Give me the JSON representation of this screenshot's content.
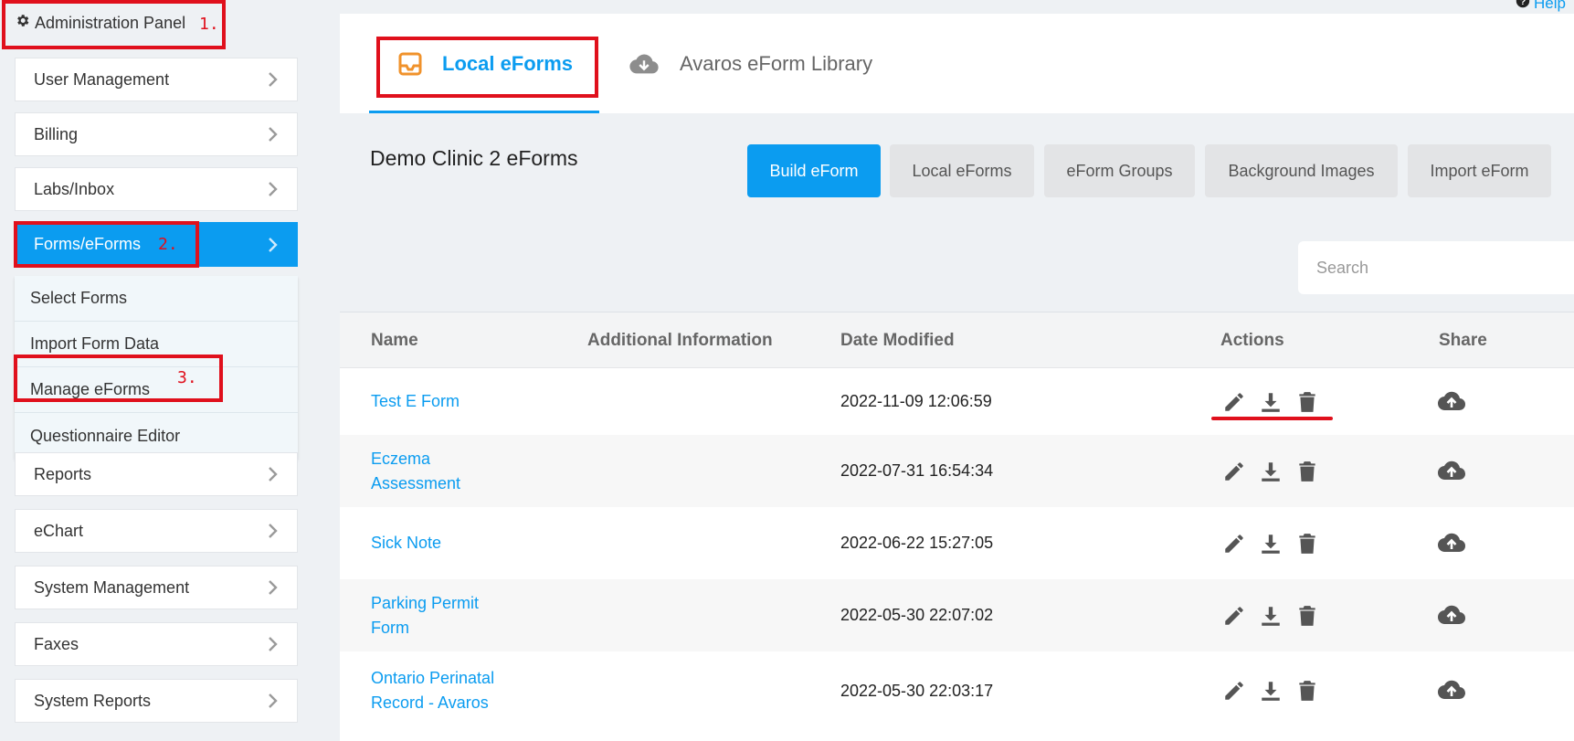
{
  "admin_panel": {
    "title": "Administration Panel"
  },
  "annotations": {
    "step1": "1.",
    "step2": "2.",
    "step3": "3."
  },
  "sidebar": {
    "items": [
      {
        "label": "User Management"
      },
      {
        "label": "Billing"
      },
      {
        "label": "Labs/Inbox"
      },
      {
        "label": "Forms/eForms"
      },
      {
        "label": "Reports"
      },
      {
        "label": "eChart"
      },
      {
        "label": "System Management"
      },
      {
        "label": "Faxes"
      },
      {
        "label": "System Reports"
      }
    ],
    "forms_submenu": [
      {
        "label": "Select Forms"
      },
      {
        "label": "Import Form Data"
      },
      {
        "label": "Manage eForms"
      },
      {
        "label": "Questionnaire Editor"
      }
    ]
  },
  "help": {
    "label": "Help"
  },
  "tabs": {
    "local": "Local eForms",
    "library": "Avaros eForm Library"
  },
  "page": {
    "clinic_title": "Demo Clinic 2 eForms"
  },
  "toolbar": {
    "build": "Build eForm",
    "local": "Local eForms",
    "groups": "eForm Groups",
    "backgrounds": "Background Images",
    "import": "Import eForm"
  },
  "search": {
    "placeholder": "Search"
  },
  "table": {
    "headers": {
      "name": "Name",
      "info": "Additional Information",
      "date": "Date Modified",
      "actions": "Actions",
      "share": "Share"
    },
    "rows": [
      {
        "name_line1": "Test E Form",
        "name_line2": "",
        "info": "",
        "date": "2022-11-09 12:06:59"
      },
      {
        "name_line1": "Eczema",
        "name_line2": "Assessment",
        "info": "",
        "date": "2022-07-31 16:54:34"
      },
      {
        "name_line1": "Sick Note",
        "name_line2": "",
        "info": "",
        "date": "2022-06-22 15:27:05"
      },
      {
        "name_line1": "Parking Permit",
        "name_line2": "Form",
        "info": "",
        "date": "2022-05-30 22:07:02"
      },
      {
        "name_line1": "Ontario Perinatal",
        "name_line2": "Record - Avaros",
        "info": "",
        "date": "2022-05-30 22:03:17"
      }
    ]
  },
  "icons": {
    "settings": "gear-icon",
    "chevron": "chevron-right-icon",
    "inbox": "inbox-icon",
    "cloud_download": "cloud-download-icon",
    "edit": "pencil-icon",
    "download": "download-icon",
    "delete": "trash-icon",
    "share": "cloud-upload-icon",
    "help": "question-circle-icon"
  },
  "colors": {
    "accent": "#0b9cf0",
    "annotation_red": "#e0101c",
    "inbox_orange": "#f0922b"
  }
}
